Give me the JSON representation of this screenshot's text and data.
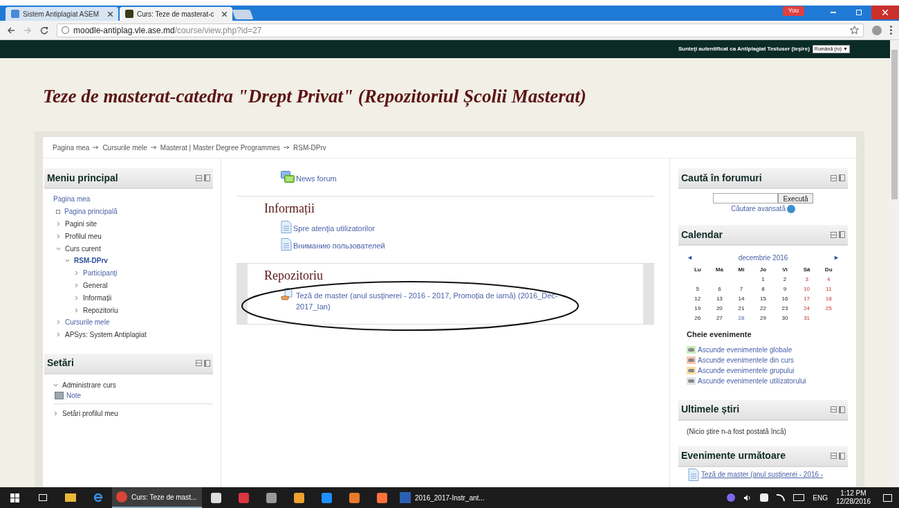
{
  "browser": {
    "tabs": [
      {
        "label": "Sistem Antiplagiat ASEM",
        "selected": false
      },
      {
        "label": "Curs: Teze de masterat-c",
        "selected": true
      }
    ],
    "profile": "You",
    "url_host": "moodle-antiplag.vle.ase.md",
    "url_path": "/course/view.php?id=27"
  },
  "topbar": {
    "login_text": "Sunteţi autentificat ca Antiplagiat Testuser (Ieşire)",
    "language": "Română (ro) ▼"
  },
  "page_title": "Teze de masterat-catedra \"Drept Privat\" (Repozitoriul Școlii Masterat)",
  "breadcrumb": [
    "Pagina mea",
    "Cursurile mele",
    "Masterat | Master Degree Programmes",
    "RSM-DPrv"
  ],
  "main_menu": {
    "title": "Meniu principal",
    "items": [
      {
        "label": "Pagina mea",
        "kind": "root",
        "children": [
          {
            "label": "Pagina principală",
            "kind": "leaf"
          },
          {
            "label": "Pagini site",
            "kind": "branch",
            "expanded": false
          },
          {
            "label": "Profilul meu",
            "kind": "branch",
            "expanded": false
          },
          {
            "label": "Curs curent",
            "kind": "branch",
            "expanded": true,
            "children": [
              {
                "label": "RSM-DPrv",
                "kind": "course",
                "expanded": true,
                "children": [
                  {
                    "label": "Participanți",
                    "kind": "link",
                    "expanded": false
                  },
                  {
                    "label": "General",
                    "kind": "branch",
                    "expanded": false
                  },
                  {
                    "label": "Informații",
                    "kind": "branch",
                    "expanded": false
                  },
                  {
                    "label": "Repozitoriu",
                    "kind": "branch",
                    "expanded": false
                  }
                ]
              }
            ]
          },
          {
            "label": "Cursurile mele",
            "kind": "link",
            "expanded": false
          },
          {
            "label": "APSys: System Antiplagiat",
            "kind": "branch",
            "expanded": false
          }
        ]
      }
    ]
  },
  "settings": {
    "title": "Setări",
    "items": [
      {
        "label": "Administrare curs",
        "expanded": true,
        "children": [
          {
            "label": "Note"
          }
        ]
      },
      {
        "label": "Setări profilul meu",
        "expanded": false
      }
    ]
  },
  "sections": [
    {
      "activities": [
        {
          "label": "News forum",
          "kind": "forum"
        }
      ],
      "highlighted": false
    },
    {
      "title": "Informații",
      "activities": [
        {
          "label": "Spre atenţia utilizatorilor",
          "kind": "page"
        },
        {
          "label": "Вниманию пользователей",
          "kind": "page"
        }
      ],
      "highlighted": false
    },
    {
      "title": "Repozitoriu",
      "activities": [
        {
          "label": "Teză de master (anul susţinerei - 2016 - 2017, Promoția de iarnă) (2016_Dec-2017_Ian)",
          "kind": "assignment"
        }
      ],
      "highlighted": true
    }
  ],
  "search_forums": {
    "title": "Caută în forumuri",
    "button": "Execută",
    "advanced": "Căutare avansată"
  },
  "calendar": {
    "title": "Calendar",
    "month": "decembrie 2016",
    "prev": "◄",
    "next": "►",
    "weekdays": [
      "Lu",
      "Ma",
      "Mi",
      "Jo",
      "Vi",
      "Sâ",
      "Du"
    ],
    "weeks": [
      [
        {
          "kind": "blank"
        },
        {
          "kind": "blank"
        },
        {
          "kind": "blank"
        },
        {
          "day": "1",
          "kind": "weekday"
        },
        {
          "day": "2",
          "kind": "weekday"
        },
        {
          "day": "3",
          "kind": "weekend"
        },
        {
          "day": "4",
          "kind": "weekend"
        }
      ],
      [
        {
          "day": "5",
          "kind": "weekday"
        },
        {
          "day": "6",
          "kind": "weekday"
        },
        {
          "day": "7",
          "kind": "weekday"
        },
        {
          "day": "8",
          "kind": "weekday"
        },
        {
          "day": "9",
          "kind": "weekday"
        },
        {
          "day": "10",
          "kind": "weekend"
        },
        {
          "day": "11",
          "kind": "weekend"
        }
      ],
      [
        {
          "day": "12",
          "kind": "weekday"
        },
        {
          "day": "13",
          "kind": "weekday"
        },
        {
          "day": "14",
          "kind": "weekday"
        },
        {
          "day": "15",
          "kind": "weekday"
        },
        {
          "day": "16",
          "kind": "weekday"
        },
        {
          "day": "17",
          "kind": "weekend"
        },
        {
          "day": "18",
          "kind": "weekend"
        }
      ],
      [
        {
          "day": "19",
          "kind": "weekday"
        },
        {
          "day": "20",
          "kind": "weekday"
        },
        {
          "day": "21",
          "kind": "weekday"
        },
        {
          "day": "22",
          "kind": "weekday"
        },
        {
          "day": "23",
          "kind": "weekday"
        },
        {
          "day": "24",
          "kind": "weekend"
        },
        {
          "day": "25",
          "kind": "weekend"
        }
      ],
      [
        {
          "day": "26",
          "kind": "weekday"
        },
        {
          "day": "27",
          "kind": "weekday"
        },
        {
          "day": "28",
          "kind": "today"
        },
        {
          "day": "29",
          "kind": "weekday"
        },
        {
          "day": "30",
          "kind": "weekday"
        },
        {
          "day": "31",
          "kind": "weekend"
        },
        {
          "kind": "blank"
        }
      ]
    ],
    "key_title": "Cheie evenimente",
    "key": [
      {
        "label": "Ascunde evenimentele globale",
        "color": "#c8ecc0"
      },
      {
        "label": "Ascunde evenimentele din curs",
        "color": "#f6c6b4"
      },
      {
        "label": "Ascunde evenimentele grupului",
        "color": "#f8e0a0"
      },
      {
        "label": "Ascunde evenimentele utilizatorului",
        "color": "#dde3e6"
      }
    ]
  },
  "latest_news": {
    "title": "Ultimele știri",
    "text": "(Nicio știre n-a fost postată încă)"
  },
  "upcoming": {
    "title": "Evenimente următoare",
    "items": [
      "Teză de master (anul susţinerei - 2016 -"
    ]
  },
  "taskbar": {
    "apps": [
      {
        "label": "Curs: Teze de mast...",
        "kind": "chrome",
        "selected": true
      },
      {
        "label": "2016_2017-Instr_ant...",
        "kind": "word",
        "selected": false
      }
    ],
    "language": "ENG",
    "time": "1:12 PM",
    "date": "12/28/2016"
  }
}
